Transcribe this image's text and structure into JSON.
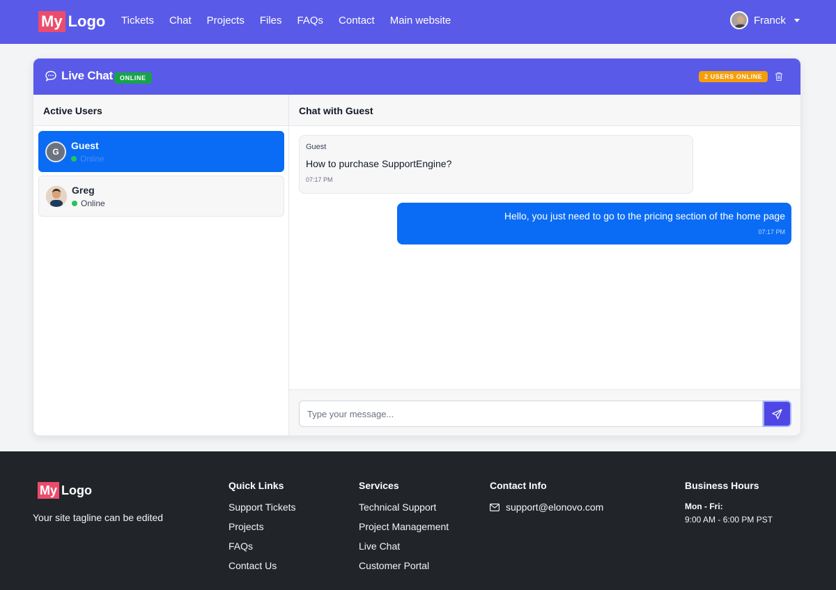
{
  "navbar": {
    "logo_my": "My",
    "logo_text": "Logo",
    "links": [
      "Tickets",
      "Chat",
      "Projects",
      "Files",
      "FAQs",
      "Contact",
      "Main website"
    ],
    "user_name": "Franck"
  },
  "chat": {
    "title": "Live Chat",
    "status_badge": "ONLINE",
    "users_badge": "2 USERS ONLINE",
    "active_users_heading": "Active Users",
    "users": [
      {
        "initial": "G",
        "name": "Guest",
        "status": "Online"
      },
      {
        "initial": "",
        "name": "Greg",
        "status": "Online"
      }
    ],
    "conversation_heading": "Chat with Guest",
    "messages": [
      {
        "sender": "Guest",
        "text": "How to purchase SupportEngine?",
        "time": "07:17 PM"
      },
      {
        "text": "Hello, you just need to go to the pricing section of the home page",
        "time": "07:17 PM"
      }
    ],
    "input_placeholder": "Type your message..."
  },
  "footer": {
    "logo_my": "My",
    "logo_text": "Logo",
    "tagline": "Your site tagline can be edited",
    "quick_links": {
      "heading": "Quick Links",
      "items": [
        "Support Tickets",
        "Projects",
        "FAQs",
        "Contact Us"
      ]
    },
    "services": {
      "heading": "Services",
      "items": [
        "Technical Support",
        "Project Management",
        "Live Chat",
        "Customer Portal"
      ]
    },
    "contact": {
      "heading": "Contact Info",
      "email": "support@elonovo.com"
    },
    "hours": {
      "heading": "Business Hours",
      "label": "Mon - Fri:",
      "value": "9:00 AM - 6:00 PM PST"
    }
  },
  "colors": {
    "primary": "#5a5ae8",
    "active_blue": "#0a6cf5",
    "online_green": "#16a34a",
    "warning_orange": "#f59e0b",
    "footer_bg": "#212529",
    "logo_pink": "#ec4c6c"
  }
}
